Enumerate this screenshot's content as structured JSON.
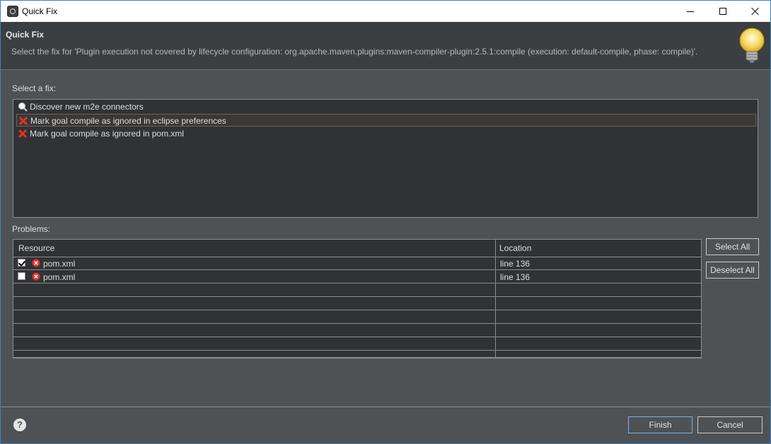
{
  "window": {
    "title": "Quick Fix",
    "controls": {
      "minimize": "minimize",
      "maximize": "maximize",
      "close": "close"
    }
  },
  "header": {
    "title": "Quick Fix",
    "description": "Select the fix for 'Plugin execution not covered by lifecycle configuration: org.apache.maven.plugins:maven-compiler-plugin:2.5.1:compile (execution: default-compile, phase: compile)'."
  },
  "fixes": {
    "label": "Select a fix:",
    "items": [
      {
        "label": "Discover new m2e connectors",
        "icon": "search-icon",
        "selected": false
      },
      {
        "label": "Mark goal compile as ignored in eclipse preferences",
        "icon": "red-x-icon",
        "selected": true
      },
      {
        "label": "Mark goal compile as ignored in pom.xml",
        "icon": "red-x-icon",
        "selected": false
      }
    ]
  },
  "problems": {
    "label": "Problems:",
    "columns": [
      "Resource",
      "Location"
    ],
    "rows": [
      {
        "checked": true,
        "resource": "pom.xml",
        "location": "line 136"
      },
      {
        "checked": false,
        "resource": "pom.xml",
        "location": "line 136"
      }
    ],
    "select_all": "Select All",
    "deselect_all": "Deselect All"
  },
  "footer": {
    "finish": "Finish",
    "cancel": "Cancel",
    "help_icon": "help-icon"
  },
  "colors": {
    "background": "#4f5254",
    "list_background": "#303335",
    "default_button_border": "#7ab0e4",
    "error_red": "#e0332d"
  }
}
